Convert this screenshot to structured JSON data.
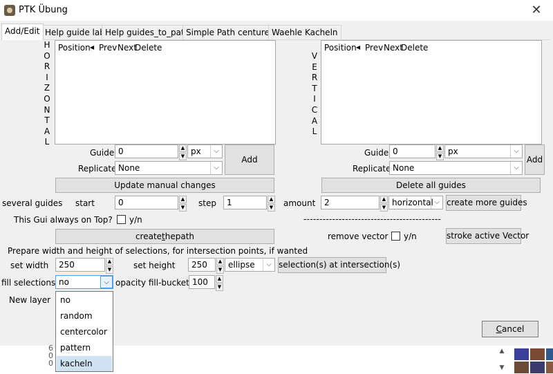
{
  "window": {
    "title": "PTK Übung",
    "close_label": "✕"
  },
  "tabs": [
    "Add/Edit",
    "Help guide lab",
    "Help guides_to_path",
    "Simple Path centured",
    "Waehle Kacheln"
  ],
  "horizontal": {
    "vertical_label": [
      "H",
      "O",
      "R",
      "I",
      "Z",
      "O",
      "N",
      "T",
      "A",
      "L"
    ],
    "columns": [
      "Position",
      "Prev",
      "Next",
      "Delete"
    ],
    "guide_label": "Guide",
    "guide_value": "0",
    "unit": "px",
    "add_label": "Add",
    "replicate_label": "Replicate",
    "replicate_value": "None",
    "update_label": "Update manual changes"
  },
  "vertical": {
    "vertical_label": [
      "V",
      "E",
      "R",
      "T",
      "I",
      "C",
      "A",
      "L"
    ],
    "columns": [
      "Position",
      "Prev",
      "Next",
      "Delete"
    ],
    "guide_label": "Guide",
    "guide_value": "0",
    "unit": "px",
    "add_label": "Add",
    "replicate_label": "Replicate",
    "replicate_value": "None",
    "delete_all_label": "Delete all guides"
  },
  "several": {
    "label": "several guides",
    "start_label": "start",
    "start_value": "0",
    "step_label": "step",
    "step_value": "1",
    "amount_label": "amount",
    "amount_value": "2",
    "orientation": "horizontal",
    "create_label": "create more guides"
  },
  "on_top": {
    "label": "This Gui always on Top?",
    "check_label": "y/n"
  },
  "dashes": "-------------------------------------------",
  "createpath": {
    "before": "create",
    "underlined": "t",
    "after": "hepath"
  },
  "remove_vector": {
    "label": "remove vector",
    "check_label": "y/n"
  },
  "stroke_label": "stroke active Vector",
  "prepare_text": "Prepare width and height of selections, for intersection points, if wanted",
  "set_width": {
    "label": "set width",
    "value": "250"
  },
  "set_height": {
    "label": "set height",
    "value": "250"
  },
  "shape": "ellipse",
  "selection_btn": "selection(s) at intersection(s)",
  "fill": {
    "label": "fill selections?!",
    "value": "no"
  },
  "opacity": {
    "label": "opacity fill-bucket?!",
    "value": "100"
  },
  "new_layer_label": "New layer",
  "fill_options": [
    "no",
    "random",
    "centercolor",
    "pattern",
    "kacheln"
  ],
  "cancel": {
    "underlined": "C",
    "rest": "ancel"
  },
  "background_text": [
    "6",
    "0",
    "0"
  ],
  "colors": {
    "accent_selected": "#cfe3f5",
    "button_bg": "#e1e1e1",
    "window_bg": "#f0f0f0"
  }
}
